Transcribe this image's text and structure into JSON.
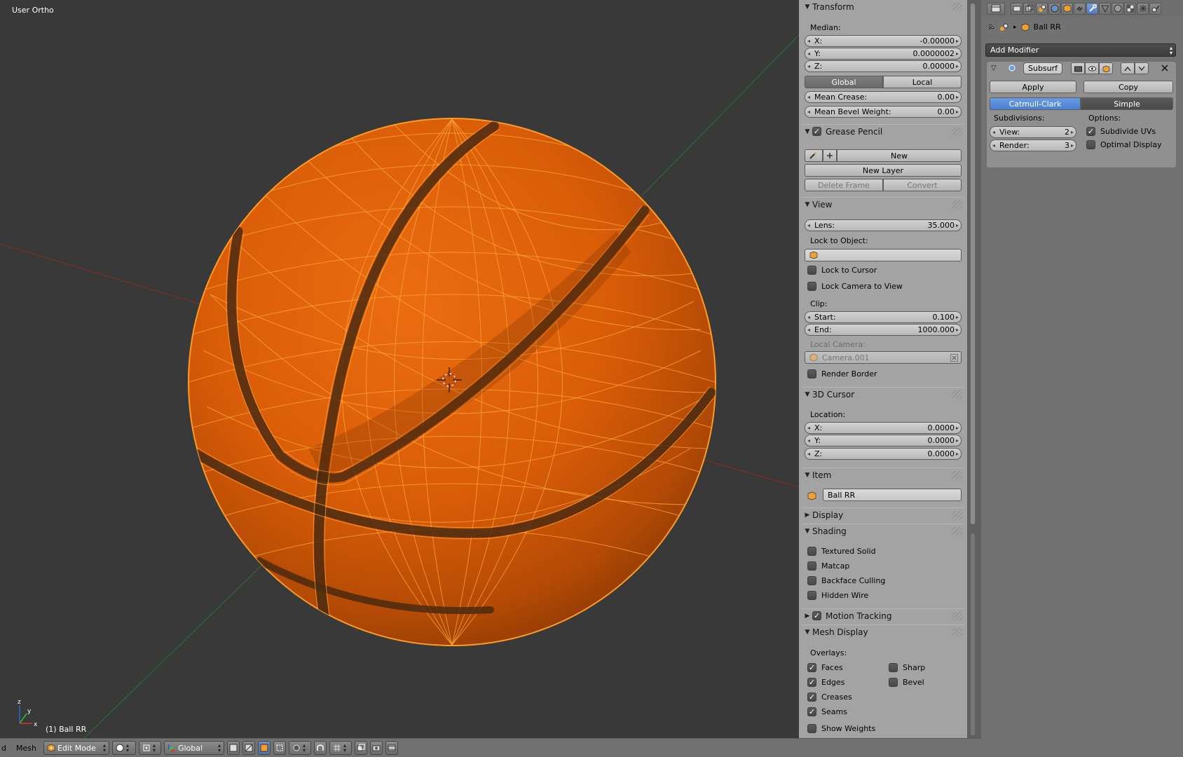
{
  "viewport": {
    "view_name": "User Ortho",
    "object_label": "(1) Ball RR"
  },
  "bottom_bar": {
    "view_menu_stub": "d",
    "mesh_menu": "Mesh",
    "mode": "Edit Mode",
    "orientation": "Global"
  },
  "n_panel": {
    "transform": {
      "title": "Transform",
      "median_label": "Median:",
      "x_label": "X:",
      "x_value": "-0.00000",
      "y_label": "Y:",
      "y_value": "0.0000002",
      "z_label": "Z:",
      "z_value": "0.00000",
      "global_label": "Global",
      "local_label": "Local",
      "mean_crease_label": "Mean Crease:",
      "mean_crease_value": "0.00",
      "mean_bevel_label": "Mean Bevel Weight:",
      "mean_bevel_value": "0.00"
    },
    "grease_pencil": {
      "title": "Grease Pencil",
      "enabled": true,
      "new_label": "New",
      "new_layer_label": "New Layer",
      "delete_frame_label": "Delete Frame",
      "convert_label": "Convert"
    },
    "view": {
      "title": "View",
      "lens_label": "Lens:",
      "lens_value": "35.000",
      "lock_object_label": "Lock to Object:",
      "lock_cursor_label": "Lock to Cursor",
      "lock_camera_label": "Lock Camera to View",
      "clip_label": "Clip:",
      "start_label": "Start:",
      "start_value": "0.100",
      "end_label": "End:",
      "end_value": "1000.000",
      "local_camera_label": "Local Camera:",
      "local_camera_value": "Camera.001",
      "render_border_label": "Render Border"
    },
    "cursor": {
      "title": "3D Cursor",
      "location_label": "Location:",
      "x_label": "X:",
      "x_value": "0.0000",
      "y_label": "Y:",
      "y_value": "0.0000",
      "z_label": "Z:",
      "z_value": "0.0000"
    },
    "item": {
      "title": "Item",
      "name_value": "Ball RR"
    },
    "display": {
      "title": "Display"
    },
    "shading": {
      "title": "Shading",
      "textured_solid": "Textured Solid",
      "matcap": "Matcap",
      "backface_culling": "Backface Culling",
      "hidden_wire": "Hidden Wire"
    },
    "motion_tracking": {
      "title": "Motion Tracking",
      "enabled": true
    },
    "mesh_display": {
      "title": "Mesh Display",
      "overlays_label": "Overlays:",
      "faces": "Faces",
      "faces_checked": true,
      "sharp": "Sharp",
      "sharp_checked": false,
      "edges": "Edges",
      "edges_checked": true,
      "bevel": "Bevel",
      "bevel_checked": false,
      "creases": "Creases",
      "creases_checked": true,
      "seams": "Seams",
      "seams_checked": true,
      "show_weights": "Show Weights",
      "show_weights_checked": false
    }
  },
  "properties": {
    "object_name": "Ball RR",
    "add_modifier_label": "Add Modifier",
    "modifier": {
      "name": "Subsurf",
      "apply_label": "Apply",
      "copy_label": "Copy",
      "catmull_label": "Catmull-Clark",
      "simple_label": "Simple",
      "subdivisions_label": "Subdivisions:",
      "options_label": "Options:",
      "view_label": "View:",
      "view_value": "2",
      "render_label": "Render:",
      "render_value": "3",
      "subdivide_uvs_label": "Subdivide UVs",
      "subdivide_uvs_checked": true,
      "optimal_display_label": "Optimal Display",
      "optimal_display_checked": false
    }
  },
  "colors": {
    "viewport_bg": "#393939",
    "ball_orange": "#e0620b",
    "wire": "#ffa020",
    "panel_bg": "#a3a3a3",
    "accent_blue": "#5a8fdc"
  }
}
